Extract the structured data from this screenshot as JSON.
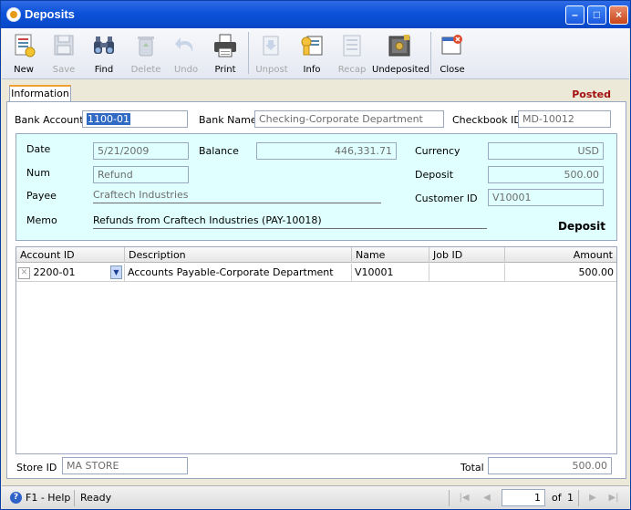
{
  "window": {
    "title": "Deposits"
  },
  "toolbar": {
    "new": "New",
    "save": "Save",
    "find": "Find",
    "delete": "Delete",
    "undo": "Undo",
    "print": "Print",
    "unpost": "Unpost",
    "info": "Info",
    "recap": "Recap",
    "undeposited": "Undeposited",
    "close": "Close"
  },
  "tabs": {
    "information": "Information"
  },
  "status_badge": "Posted",
  "header": {
    "bank_account_label": "Bank Account",
    "bank_account_value": "1100-01",
    "bank_name_label": "Bank Name",
    "bank_name_value": "Checking-Corporate Department",
    "checkbook_label": "Checkbook ID",
    "checkbook_value": "MD-10012"
  },
  "details": {
    "date_label": "Date",
    "date_value": "5/21/2009",
    "balance_label": "Balance",
    "balance_value": "446,331.71",
    "currency_label": "Currency",
    "currency_value": "USD",
    "num_label": "Num",
    "num_value": "Refund",
    "deposit_label": "Deposit",
    "deposit_value": "500.00",
    "payee_label": "Payee",
    "payee_value": "Craftech Industries",
    "customer_label": "Customer ID",
    "customer_value": "V10001",
    "memo_label": "Memo",
    "memo_value": "Refunds from Craftech Industries (PAY-10018)",
    "type_badge": "Deposit"
  },
  "grid": {
    "columns": [
      "Account ID",
      "Description",
      "Name",
      "Job ID",
      "Amount"
    ],
    "rows": [
      {
        "account_id": "2200-01",
        "description": "Accounts Payable-Corporate Department",
        "name": "V10001",
        "job_id": "",
        "amount": "500.00"
      }
    ]
  },
  "footer": {
    "store_label": "Store ID",
    "store_value": "MA STORE",
    "total_label": "Total",
    "total_value": "500.00"
  },
  "statusbar": {
    "help": "F1 - Help",
    "status": "Ready",
    "page_value": "1",
    "of_label": "of",
    "page_count": "1"
  }
}
